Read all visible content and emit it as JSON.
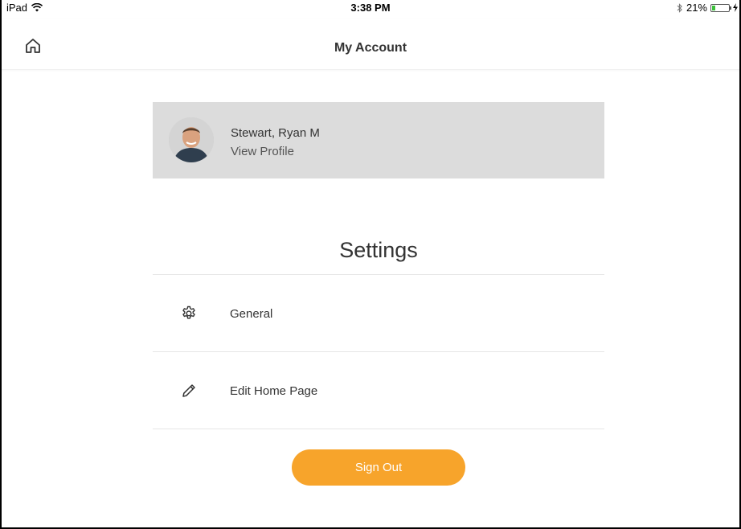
{
  "status_bar": {
    "device": "iPad",
    "time": "3:38 PM",
    "battery_percent": "21%",
    "battery_level": 0.21,
    "icons": [
      "wifi-icon",
      "bluetooth-icon",
      "battery-icon",
      "charging-icon"
    ]
  },
  "nav": {
    "title": "My Account",
    "home_icon": "home-icon"
  },
  "profile": {
    "name": "Stewart, Ryan M",
    "link": "View Profile"
  },
  "settings": {
    "heading": "Settings",
    "items": [
      {
        "label": "General",
        "icon": "gear-icon"
      },
      {
        "label": "Edit Home Page",
        "icon": "pencil-icon"
      }
    ]
  },
  "actions": {
    "sign_out": "Sign Out"
  },
  "colors": {
    "accent": "#f7a42b",
    "card_bg": "#dcdcdc",
    "battery_fill": "#3cc13b"
  }
}
